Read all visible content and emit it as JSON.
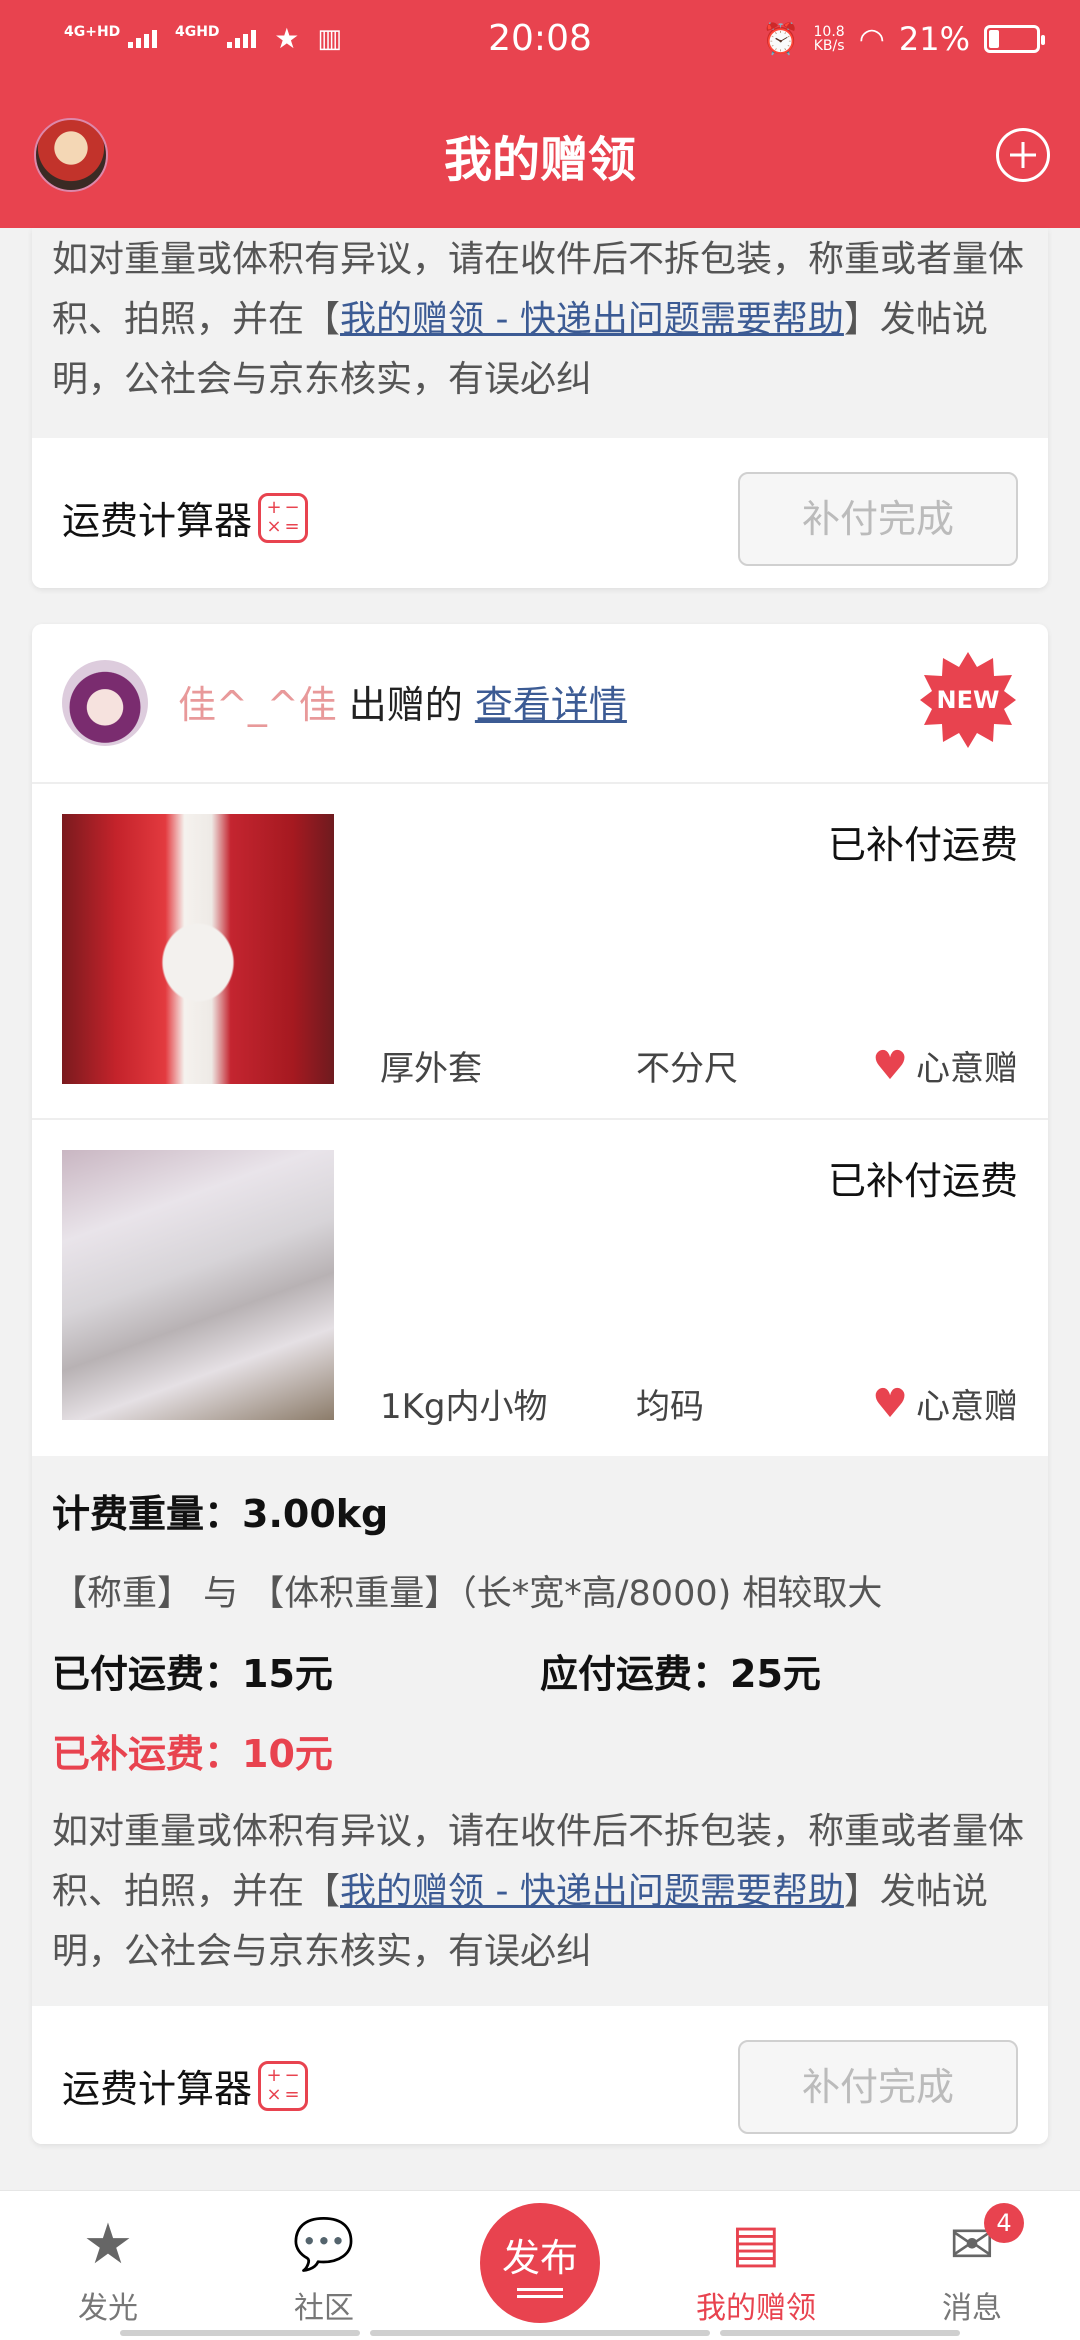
{
  "status_bar": {
    "signal_1": "4G+HD",
    "signal_2": "4GHD",
    "time": "20:08",
    "speed": "10.8\nKB/s",
    "battery": "21%"
  },
  "header": {
    "title": "我的赠领"
  },
  "card_top": {
    "notice_part1": "如对重量或体积有异议，请在收件后不拆包装，称重或者量体积、拍照，并在【",
    "notice_link": "我的赠领 - 快递出问题需要帮助",
    "notice_part2": "】发帖说明，公社会与京东核实，有误必纠",
    "calculator_label": "运费计算器",
    "done_button": "补付完成"
  },
  "card_main": {
    "donor_name": "佳^_^佳",
    "donated_text": "出赠的",
    "detail_link": "查看详情",
    "new_badge": "NEW",
    "items": [
      {
        "status": "已补付运费",
        "name": "厚外套",
        "size": "不分尺",
        "tag": "心意赠"
      },
      {
        "status": "已补付运费",
        "name": "1Kg内小物",
        "size": "均码",
        "tag": "心意赠"
      }
    ],
    "weight_label": "计费重量：",
    "weight_value": "3.00kg",
    "weight_rule": "【称重】 与 【体积重量】（长*宽*高/8000) 相较取大",
    "paid_label": "已付运费：",
    "paid_value": "15元",
    "due_label": "应付运费：",
    "due_value": "25元",
    "extra_label": "已补运费：",
    "extra_value": "10元",
    "notice_part1": "如对重量或体积有异议，请在收件后不拆包装，称重或者量体积、拍照，并在【",
    "notice_link": "我的赠领 - 快递出问题需要帮助",
    "notice_part2": "】发帖说明，公社会与京东核实，有误必纠",
    "calculator_label": "运费计算器",
    "done_button": "补付完成"
  },
  "tabbar": {
    "tabs": [
      {
        "label": "发光",
        "icon": "star-icon"
      },
      {
        "label": "社区",
        "icon": "chat-icon"
      },
      {
        "label": "发布",
        "icon": "publish-icon"
      },
      {
        "label": "我的赠领",
        "icon": "gift-box-icon"
      },
      {
        "label": "消息",
        "icon": "mail-icon"
      }
    ],
    "message_badge": "4",
    "active_color": "#e8434f"
  },
  "colors": {
    "brand": "#e8434f",
    "link": "#3c5b94"
  }
}
